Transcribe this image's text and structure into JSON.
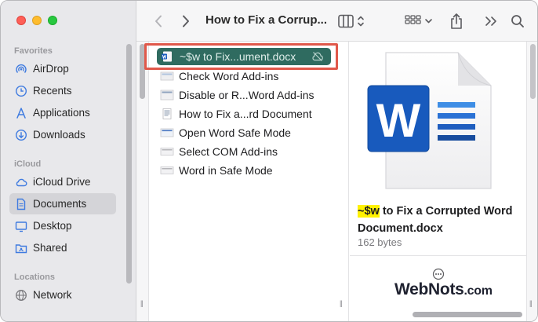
{
  "window": {
    "title": "How to Fix a Corrupted Word Document",
    "title_display": "How to Fix a Corrup..."
  },
  "sidebar": {
    "sections": [
      {
        "label": "Favorites",
        "items": [
          {
            "label": "AirDrop",
            "icon": "airdrop-icon"
          },
          {
            "label": "Recents",
            "icon": "clock-icon"
          },
          {
            "label": "Applications",
            "icon": "applications-icon"
          },
          {
            "label": "Downloads",
            "icon": "download-icon"
          }
        ]
      },
      {
        "label": "iCloud",
        "items": [
          {
            "label": "iCloud Drive",
            "icon": "cloud-icon"
          },
          {
            "label": "Documents",
            "icon": "document-icon",
            "selected": true
          },
          {
            "label": "Desktop",
            "icon": "desktop-icon"
          },
          {
            "label": "Shared",
            "icon": "shared-folder-icon"
          }
        ]
      },
      {
        "label": "Locations",
        "items": [
          {
            "label": "Network",
            "icon": "globe-icon"
          }
        ]
      }
    ]
  },
  "files": [
    {
      "name": "~$w to Fix...ument.docx",
      "selected": true,
      "status": "cloud-offline-icon"
    },
    {
      "name": "Check Word Add-ins"
    },
    {
      "name": "Disable or R...Word Add-ins"
    },
    {
      "name": "How to Fix a...rd Document"
    },
    {
      "name": "Open Word Safe Mode"
    },
    {
      "name": "Select COM Add-ins"
    },
    {
      "name": "Word in Safe Mode"
    }
  ],
  "preview": {
    "name_highlight": "~$w",
    "name_rest": " to Fix a Corrupted Word Document.docx",
    "size": "162 bytes",
    "app_letter": "W"
  },
  "watermark": {
    "text_main": "WebNots",
    "text_suffix": ".com"
  },
  "colors": {
    "selection_row": "#2f6b60",
    "highlight_box": "#e0584a",
    "text_highlight": "#fff200",
    "word_blue": "#185abd"
  }
}
